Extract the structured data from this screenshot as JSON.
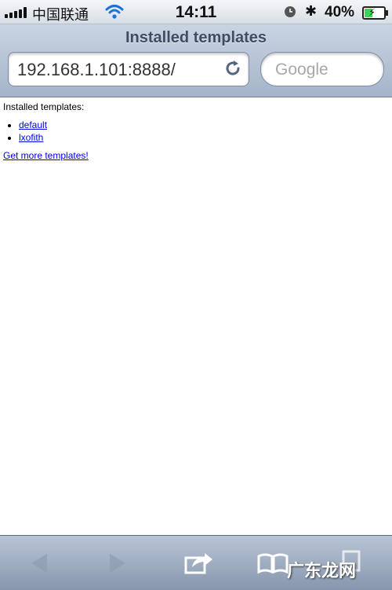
{
  "status_bar": {
    "carrier": "中国联通",
    "time": "14:11",
    "battery_percent": "40%",
    "battery_level": 0.4,
    "icons": [
      "signal-icon",
      "wifi-icon",
      "alarm-icon",
      "bluetooth-icon",
      "battery-icon"
    ]
  },
  "browser": {
    "title": "Installed templates",
    "url": "192.168.1.101:8888/",
    "search_placeholder": "Google",
    "reload_icon": "reload-icon"
  },
  "content": {
    "heading": "Installed templates:",
    "templates": [
      "default",
      "lxofith"
    ],
    "more_link": "Get more templates!"
  },
  "toolbar": {
    "icons": [
      "back-icon",
      "forward-icon",
      "share-icon",
      "bookmarks-icon",
      "pages-icon"
    ],
    "watermark": "广东龙网"
  }
}
